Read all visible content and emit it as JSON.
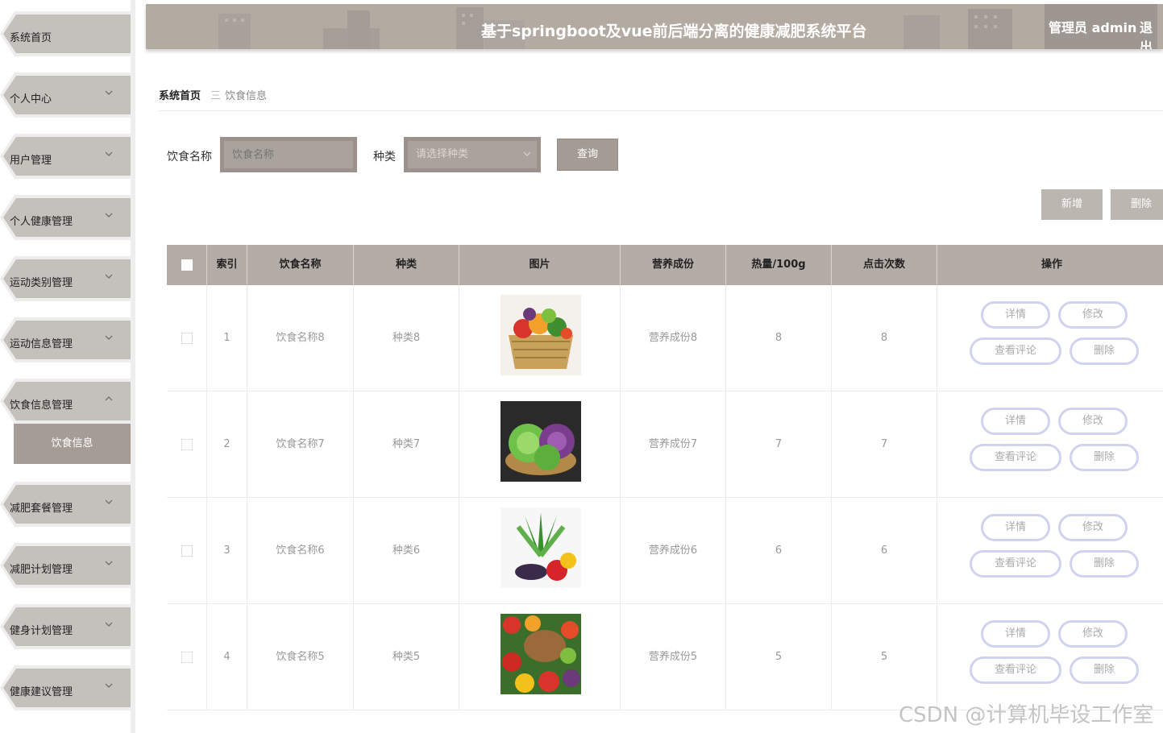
{
  "header": {
    "title": "基于springboot及vue前后端分离的健康减肥系统平台",
    "admin": "管理员 admin",
    "logout": "退出"
  },
  "sidebar": {
    "items": [
      {
        "label": "系统首页"
      },
      {
        "label": "个人中心"
      },
      {
        "label": "用户管理"
      },
      {
        "label": "个人健康管理"
      },
      {
        "label": "运动类别管理"
      },
      {
        "label": "运动信息管理"
      },
      {
        "label": "饮食信息管理"
      },
      {
        "label": "减肥套餐管理"
      },
      {
        "label": "减肥计划管理"
      },
      {
        "label": "健身计划管理"
      },
      {
        "label": "健康建议管理"
      }
    ],
    "sub_item": "饮食信息"
  },
  "breadcrumb": {
    "home": "系统首页",
    "separator": "三",
    "current": "饮食信息"
  },
  "search": {
    "name_label": "饮食名称",
    "name_placeholder": "饮食名称",
    "type_label": "种类",
    "type_placeholder": "请选择种类",
    "query": "查询"
  },
  "actions": {
    "add": "新增",
    "delete": "删除"
  },
  "table": {
    "headers": [
      "索引",
      "饮食名称",
      "种类",
      "图片",
      "营养成份",
      "热量/100g",
      "点击次数",
      "操作"
    ],
    "rows": [
      {
        "index": "1",
        "name": "饮食名称8",
        "type": "种类8",
        "nutrition": "营养成份8",
        "calories": "8",
        "clicks": "8",
        "image": "vegetable-basket"
      },
      {
        "index": "2",
        "name": "饮食名称7",
        "type": "种类7",
        "nutrition": "营养成份7",
        "calories": "7",
        "clicks": "7",
        "image": "cabbage-basket"
      },
      {
        "index": "3",
        "name": "饮食名称6",
        "type": "种类6",
        "nutrition": "营养成份6",
        "calories": "6",
        "clicks": "6",
        "image": "leafy-vegetables"
      },
      {
        "index": "4",
        "name": "饮食名称5",
        "type": "种类5",
        "nutrition": "营养成份5",
        "calories": "5",
        "clicks": "5",
        "image": "mixed-vegetables"
      }
    ],
    "ops": {
      "detail": "详情",
      "edit": "修改",
      "comments": "查看评论",
      "delete": "删除"
    }
  },
  "watermark": "CSDN @计算机毕设工作室",
  "colors": {
    "header": "#b3aaa2",
    "sidebar_item": "#c4c0bc",
    "submenu_active": "#a59c95",
    "table_head": "#b3aca7",
    "op_border": "#cfd3ef"
  }
}
